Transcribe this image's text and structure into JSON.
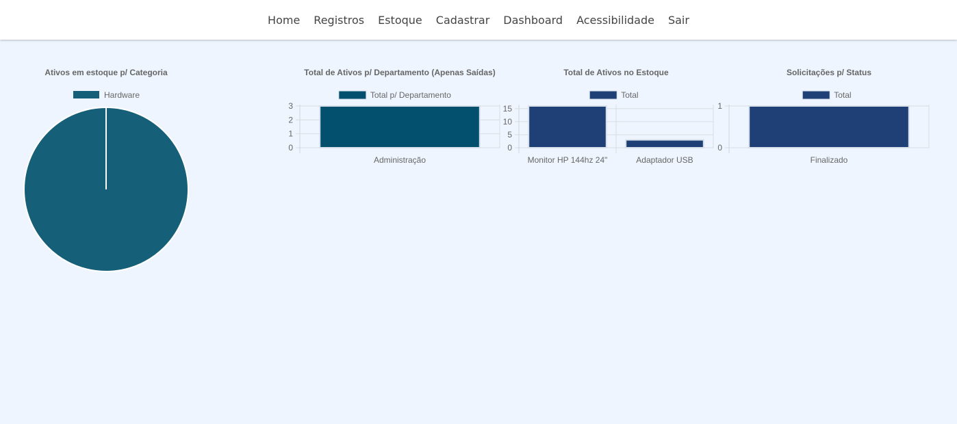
{
  "nav": {
    "items": [
      {
        "label": "Home"
      },
      {
        "label": "Registros"
      },
      {
        "label": "Estoque"
      },
      {
        "label": "Cadastrar"
      },
      {
        "label": "Dashboard"
      },
      {
        "label": "Acessibilidade"
      },
      {
        "label": "Sair"
      }
    ]
  },
  "chart_data": [
    {
      "type": "pie",
      "title": "Ativos em estoque p/ Categoria",
      "legend": [
        "Hardware"
      ],
      "categories": [
        "Hardware"
      ],
      "values": [
        1
      ],
      "colors": [
        "#155f78"
      ]
    },
    {
      "type": "bar",
      "title": "Total de Ativos p/ Departamento (Apenas Saídas)",
      "series": [
        {
          "name": "Total p/ Departamento",
          "values": [
            3
          ]
        }
      ],
      "categories": [
        "Administração"
      ],
      "yticks": [
        0,
        1,
        2,
        3
      ],
      "ylim": [
        0,
        3
      ],
      "colors": [
        "#02506e"
      ]
    },
    {
      "type": "bar",
      "title": "Total de Ativos no Estoque",
      "series": [
        {
          "name": "Total",
          "values": [
            16,
            3
          ]
        }
      ],
      "categories": [
        "Monitor HP 144hz 24\"",
        "Adaptador USB"
      ],
      "yticks": [
        0,
        5,
        10,
        15
      ],
      "ylim": [
        0,
        16
      ],
      "colors": [
        "#1f3f77"
      ]
    },
    {
      "type": "bar",
      "title": "Solicitações p/ Status",
      "series": [
        {
          "name": "Total",
          "values": [
            1
          ]
        }
      ],
      "categories": [
        "Finalizado"
      ],
      "yticks": [
        0,
        1
      ],
      "ylim": [
        0,
        1
      ],
      "colors": [
        "#1f3f77"
      ]
    }
  ]
}
